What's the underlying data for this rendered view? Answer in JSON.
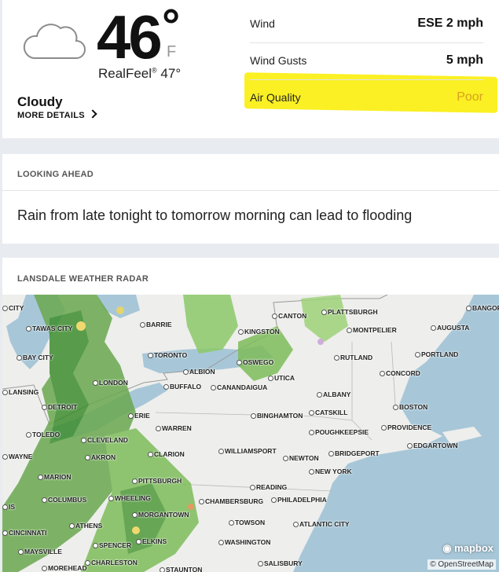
{
  "current": {
    "temperature": "46°",
    "unit": "F",
    "realfeel_label": "RealFeel",
    "realfeel_value": "47°",
    "phrase": "Cloudy",
    "more_details": "MORE DETAILS",
    "details": [
      {
        "label": "Wind",
        "value": "ESE 2 mph"
      },
      {
        "label": "Wind Gusts",
        "value": "5 mph"
      },
      {
        "label": "Air Quality",
        "value": "Poor"
      }
    ],
    "highlight_color": "#fbf023",
    "air_quality_color": "#d8a21e"
  },
  "looking_ahead": {
    "title": "LOOKING AHEAD",
    "text": "Rain from late tonight to tomorrow morning can lead to flooding"
  },
  "radar": {
    "title": "LANSDALE WEATHER RADAR",
    "mapbox_label": "mapbox",
    "attribution": "© OpenStreetMap",
    "cities": [
      "CITY",
      "TAWAS CITY",
      "BAY CITY",
      "LANSING",
      "DETROIT",
      "TOLEDO",
      "WAYNE",
      "MARION",
      "COLUMBUS",
      "CINCINNATI",
      "MAYSVILLE",
      "MOREHEAD",
      "BARRIE",
      "TORONTO",
      "ALBION",
      "LONDON",
      "BUFFALO",
      "CANANDAIGUA",
      "ERIE",
      "WARREN",
      "CLEVELAND",
      "AKRON",
      "CLARION",
      "PITTSBURGH",
      "WHEELING",
      "MORGANTOWN",
      "ATHENS",
      "SPENCER",
      "ELKINS",
      "CHARLESTON",
      "STAUNTON",
      "KINGSTON",
      "OSWEGO",
      "UTICA",
      "CANTON",
      "PLATTSBURGH",
      "MONTPELIER",
      "RUTLAND",
      "BINGHAMTON",
      "CATSKILL",
      "ALBANY",
      "POUGHKEEPSIE",
      "NEWTON",
      "BRIDGEPORT",
      "NEW YORK",
      "WILLIAMSPORT",
      "READING",
      "CHAMBERSBURG",
      "PHILADELPHIA",
      "TOWSON",
      "ATLANTIC CITY",
      "WASHINGTON",
      "SALISBURY",
      "BANGOR",
      "AUGUSTA",
      "PORTLAND",
      "CONCORD",
      "BOSTON",
      "PROVIDENCE",
      "EDGARTOWN",
      "IS"
    ]
  }
}
